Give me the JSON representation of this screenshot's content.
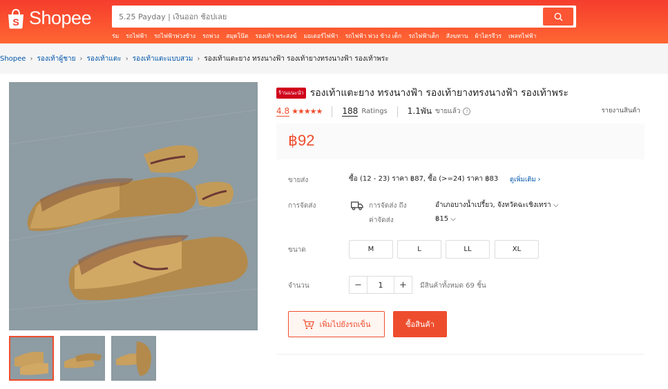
{
  "brand": {
    "name": "Shopee"
  },
  "search": {
    "placeholder": "5.25 Payday | เงินออก ช้อปเลย"
  },
  "quick_links": [
    "ร่ม",
    "รถไฟฟ้า",
    "รถไฟฟ้าพ่วงข้าง",
    "รถพ่วง",
    "สมุดโน๊ต",
    "รองเท้า พระสงฆ์",
    "มอเตอร์ไฟฟ้า",
    "รถไฟฟ้า พ่วง ข้าง เด็ก",
    "รถไฟฟ้าเด็ก",
    "สังฆทาน",
    "ผ้าไตรจีวร",
    "เพลทไฟฟ้า"
  ],
  "breadcrumb": {
    "home": "Shopee",
    "cat1": "รองเท้าผู้ชาย",
    "cat2": "รองเท้าแตะ",
    "cat3": "รองเท้าแตะแบบสวม",
    "current": "รองเท้าแตะยาง ทรงนางฟ้า รองเท้ายางทรงนางฟ้า รองเท้าพระ"
  },
  "product": {
    "badge": "ร้านแนะนำ",
    "title": "รองเท้าแตะยาง ทรงนางฟ้า รองเท้ายางทรงนางฟ้า รองเท้าพระ",
    "rating": "4.8",
    "stars": "★★★★★",
    "ratings_count": "188",
    "ratings_label": "Ratings",
    "sold_count": "1.1พัน",
    "sold_label": "ขายแล้ว",
    "report": "รายงานสินค้า",
    "price": "฿92"
  },
  "wholesale": {
    "label": "ขายส่ง",
    "value": "ซื้อ (12 - 23) ราคา ฿87, ซื้อ (>=24) ราคา ฿83",
    "more": "ดูเพิ่มเติม"
  },
  "shipping": {
    "label": "การจัดส่ง",
    "to_label": "การจัดส่ง ถึง",
    "to_value": "อำเภอบางน้ำเปรี้ยว, จังหวัดฉะเชิงเทรา",
    "fee_label": "ค่าจัดส่ง",
    "fee_value": "฿15"
  },
  "size": {
    "label": "ขนาด",
    "options": [
      "M",
      "L",
      "LL",
      "XL"
    ]
  },
  "quantity": {
    "label": "จำนวน",
    "minus": "−",
    "value": "1",
    "plus": "+",
    "stock": "มีสินค้าทั้งหมด 69 ชิ้น"
  },
  "actions": {
    "add_to_cart": "เพิ่มไปยังรถเข็น",
    "buy_now": "ซื้อสินค้า"
  },
  "colors": {
    "brand": "#ee4d2d",
    "link": "#0055aa"
  }
}
